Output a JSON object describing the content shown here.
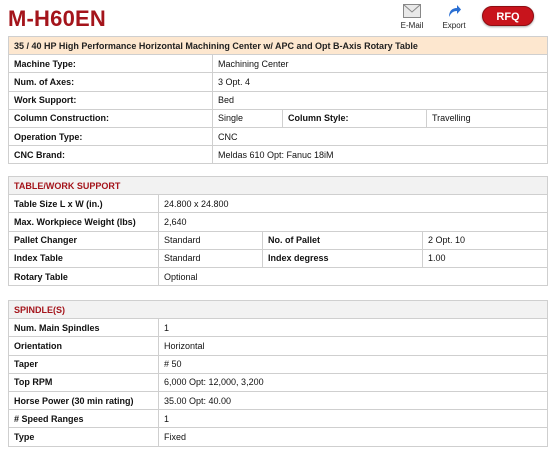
{
  "header": {
    "model": "M-H60EN",
    "email_label": "E-Mail",
    "export_label": "Export",
    "rfq_label": "RFQ"
  },
  "general": {
    "caption": "35 / 40 HP High Performance Horizontal Machining Center w/ APC and Opt B-Axis Rotary Table",
    "machine_type": {
      "label": "Machine Type:",
      "value": "Machining Center"
    },
    "axes": {
      "label": "Num. of Axes:",
      "value": "3   Opt. 4"
    },
    "work_support": {
      "label": "Work Support:",
      "value": "Bed"
    },
    "column_construction": {
      "label": "Column Construction:",
      "value": "Single"
    },
    "column_style": {
      "label": "Column Style:",
      "value": "Travelling"
    },
    "operation_type": {
      "label": "Operation Type:",
      "value": "CNC"
    },
    "cnc_brand": {
      "label": "CNC Brand:",
      "value": "Meldas 610 Opt: Fanuc 18iM"
    }
  },
  "table_work": {
    "title": "TABLE/WORK SUPPORT",
    "table_size": {
      "label": "Table Size L x W (in.)",
      "value": "24.800 x 24.800"
    },
    "max_weight": {
      "label": "Max. Workpiece Weight (lbs)",
      "value": "2,640"
    },
    "pallet_changer": {
      "label": "Pallet Changer",
      "value": "Standard"
    },
    "num_pallet": {
      "label": "No. of Pallet",
      "value": "2   Opt. 10"
    },
    "index_table": {
      "label": "Index Table",
      "value": "Standard"
    },
    "index_degrees": {
      "label": "Index degress",
      "value": "1.00"
    },
    "rotary_table": {
      "label": "Rotary Table",
      "value": "Optional"
    }
  },
  "spindle": {
    "title": "SPINDLE(S)",
    "rows": [
      {
        "label": "Num. Main Spindles",
        "value": "1"
      },
      {
        "label": "Orientation",
        "value": "Horizontal"
      },
      {
        "label": "Taper",
        "value": "# 50"
      },
      {
        "label": "Top RPM",
        "value": "6,000 Opt: 12,000, 3,200"
      },
      {
        "label": "Horse Power (30 min rating)",
        "value": "35.00   Opt: 40.00"
      },
      {
        "label": "# Speed Ranges",
        "value": "1"
      },
      {
        "label": "Type",
        "value": "Fixed"
      }
    ]
  },
  "colors": {
    "brand_red": "#a4141b",
    "caption_bg": "#fde7cf",
    "section_bg": "#f2f2f2"
  }
}
